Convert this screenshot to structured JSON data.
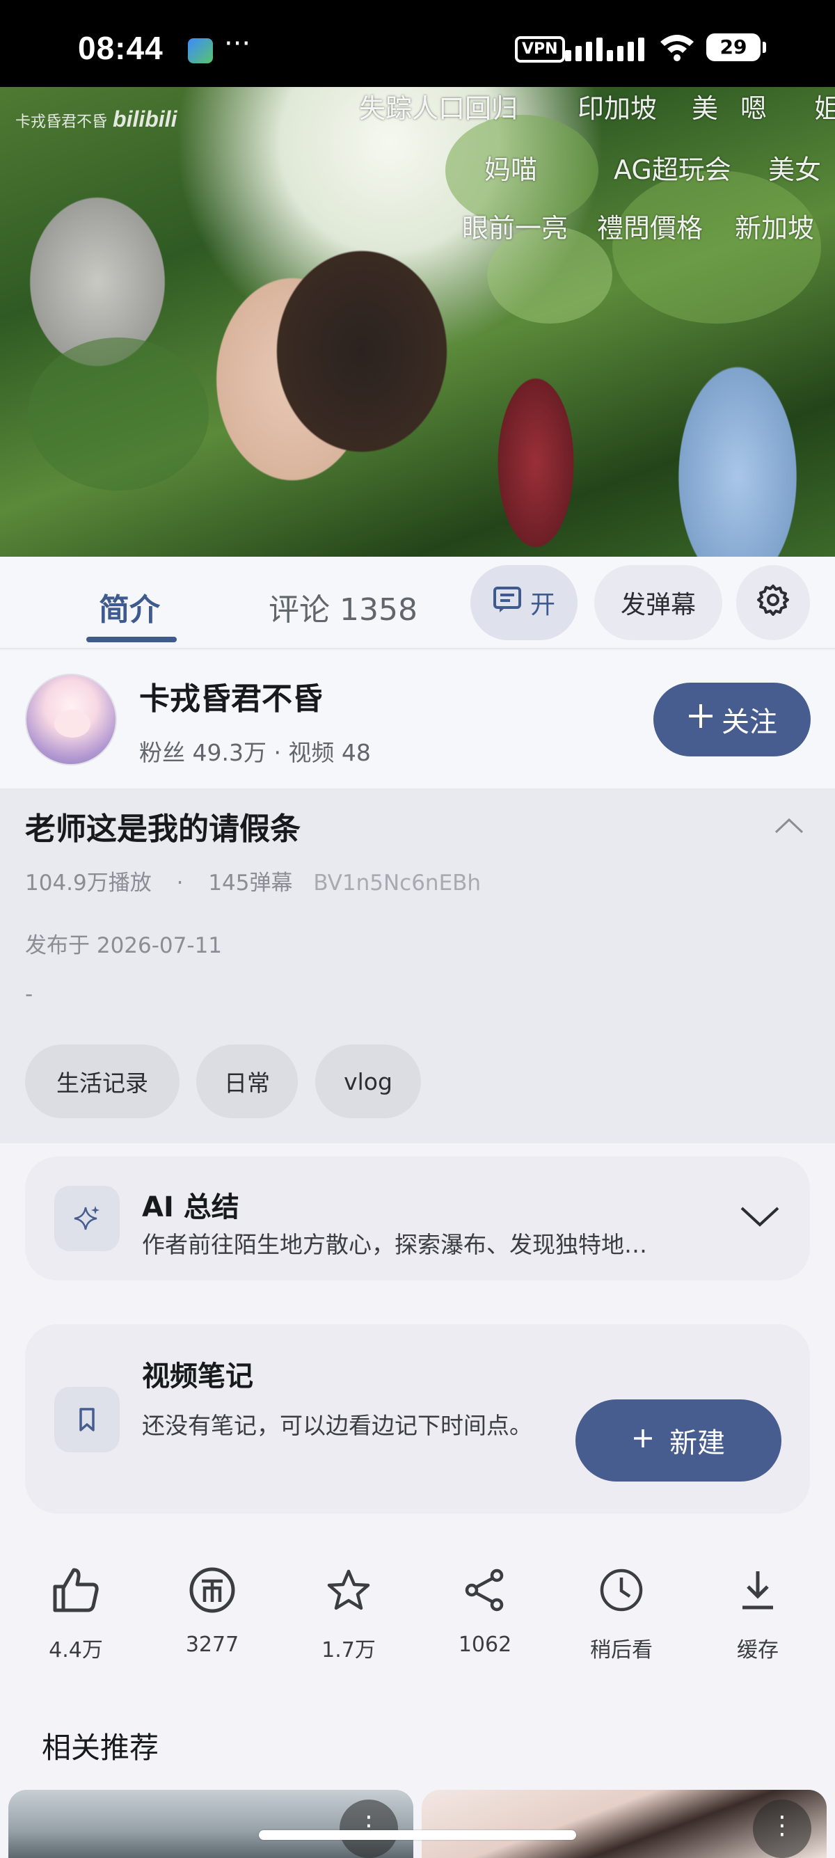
{
  "status_bar": {
    "time": "08:44",
    "more": "···",
    "vpn": "VPN",
    "battery": "29"
  },
  "video": {
    "watermark_user": "卡戎昏君不昏",
    "watermark_brand": "bilibili",
    "danmaku": [
      "失踪人口回归",
      "印加坡",
      "美",
      "嗯",
      "姐",
      "妈喵",
      "AG超玩会",
      "美女",
      "眼前一亮",
      "禮問價格",
      "新加坡"
    ]
  },
  "tabs": {
    "intro": "简介",
    "comments": "评论 1358",
    "danmaku_toggle": "开",
    "send_danmaku": "发弹幕"
  },
  "uploader": {
    "name": "卡戎昏君不昏",
    "stats": "粉丝 49.3万 · 视频 48",
    "follow": "关注"
  },
  "video_info": {
    "title": "老师这是我的请假条",
    "plays": "104.9万播放",
    "separator": "·",
    "danmaku_count": "145弹幕",
    "bvid": "BV1n5Nc6nEBh",
    "date": "发布于 2026-07-11",
    "description": "-",
    "tags": [
      "生活记录",
      "日常",
      "vlog"
    ]
  },
  "ai_summary": {
    "title": "AI 总结",
    "text": "作者前往陌生地方散心，探索瀑布、发现独特地…"
  },
  "notes": {
    "title": "视频笔记",
    "text": "还没有笔记，可以边看边记下时间点。",
    "new_button": "新建"
  },
  "actions": [
    {
      "label": "4.4万",
      "icon": "like-icon"
    },
    {
      "label": "3277",
      "icon": "coin-icon"
    },
    {
      "label": "1.7万",
      "icon": "star-icon"
    },
    {
      "label": "1062",
      "icon": "share-icon"
    },
    {
      "label": "稍后看",
      "icon": "clock-icon"
    },
    {
      "label": "缓存",
      "icon": "download-icon"
    }
  ],
  "related": {
    "title": "相关推荐"
  },
  "colors": {
    "accent": "#475c8f",
    "tab_active": "#3f5a8f"
  }
}
